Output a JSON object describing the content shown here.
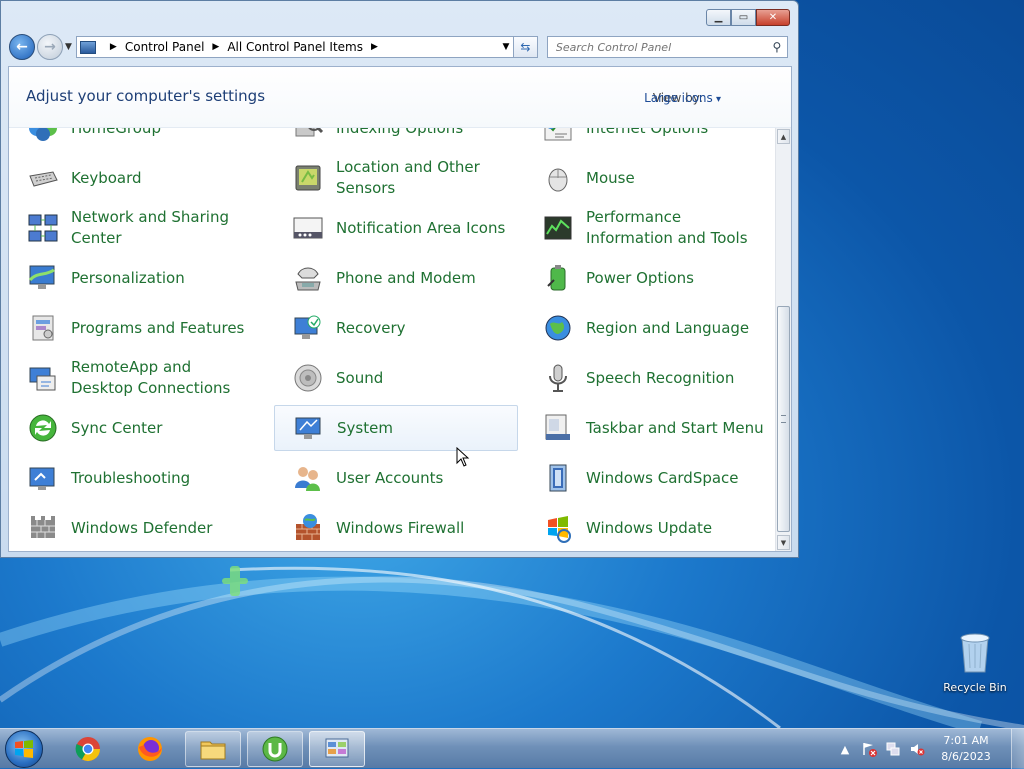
{
  "window": {
    "caption_buttons": {
      "minimize_icon": "minimize-icon",
      "maximize_icon": "maximize-icon",
      "close_icon": "close-icon"
    }
  },
  "navbar": {
    "breadcrumb": [
      "Control Panel",
      "All Control Panel Items"
    ],
    "search_placeholder": "Search Control Panel"
  },
  "content": {
    "title": "Adjust your computer's settings",
    "view_by_label": "View by:",
    "view_by_value": "Large icons"
  },
  "items": [
    {
      "label": "HomeGroup",
      "icon": "homegroup-icon",
      "col": 0,
      "row": 0,
      "clip": true
    },
    {
      "label": "Indexing Options",
      "icon": "indexing-options-icon",
      "col": 1,
      "row": 0,
      "clip": true
    },
    {
      "label": "Internet Options",
      "icon": "internet-options-icon",
      "col": 2,
      "row": 0,
      "clip": true
    },
    {
      "label": "Keyboard",
      "icon": "keyboard-icon",
      "col": 0,
      "row": 1
    },
    {
      "label": "Location and Other Sensors",
      "icon": "location-sensors-icon",
      "col": 1,
      "row": 1
    },
    {
      "label": "Mouse",
      "icon": "mouse-icon",
      "col": 2,
      "row": 1
    },
    {
      "label": "Network and Sharing Center",
      "icon": "network-icon",
      "col": 0,
      "row": 2
    },
    {
      "label": "Notification Area Icons",
      "icon": "notification-area-icon",
      "col": 1,
      "row": 2
    },
    {
      "label": "Performance Information and Tools",
      "icon": "performance-icon",
      "col": 2,
      "row": 2
    },
    {
      "label": "Personalization",
      "icon": "personalization-icon",
      "col": 0,
      "row": 3
    },
    {
      "label": "Phone and Modem",
      "icon": "phone-modem-icon",
      "col": 1,
      "row": 3
    },
    {
      "label": "Power Options",
      "icon": "power-options-icon",
      "col": 2,
      "row": 3
    },
    {
      "label": "Programs and Features",
      "icon": "programs-features-icon",
      "col": 0,
      "row": 4
    },
    {
      "label": "Recovery",
      "icon": "recovery-icon",
      "col": 1,
      "row": 4
    },
    {
      "label": "Region and Language",
      "icon": "region-language-icon",
      "col": 2,
      "row": 4
    },
    {
      "label": "RemoteApp and Desktop Connections",
      "icon": "remoteapp-icon",
      "col": 0,
      "row": 5
    },
    {
      "label": "Sound",
      "icon": "sound-icon",
      "col": 1,
      "row": 5
    },
    {
      "label": "Speech Recognition",
      "icon": "speech-recognition-icon",
      "col": 2,
      "row": 5
    },
    {
      "label": "Sync Center",
      "icon": "sync-center-icon",
      "col": 0,
      "row": 6
    },
    {
      "label": "System",
      "icon": "system-icon",
      "col": 1,
      "row": 6,
      "hover": true
    },
    {
      "label": "Taskbar and Start Menu",
      "icon": "taskbar-start-menu-icon",
      "col": 2,
      "row": 6
    },
    {
      "label": "Troubleshooting",
      "icon": "troubleshooting-icon",
      "col": 0,
      "row": 7
    },
    {
      "label": "User Accounts",
      "icon": "user-accounts-icon",
      "col": 1,
      "row": 7
    },
    {
      "label": "Windows CardSpace",
      "icon": "cardspace-icon",
      "col": 2,
      "row": 7
    },
    {
      "label": "Windows Defender",
      "icon": "defender-icon",
      "col": 0,
      "row": 8
    },
    {
      "label": "Windows Firewall",
      "icon": "firewall-icon",
      "col": 1,
      "row": 8
    },
    {
      "label": "Windows Update",
      "icon": "windows-update-icon",
      "col": 2,
      "row": 8
    }
  ],
  "desktop": {
    "recycle_bin_label": "Recycle Bin"
  },
  "taskbar": {
    "apps": [
      {
        "name": "chrome",
        "icon": "chrome-icon"
      },
      {
        "name": "firefox",
        "icon": "firefox-icon"
      },
      {
        "name": "explorer",
        "icon": "folder-icon"
      },
      {
        "name": "utorrent",
        "icon": "utorrent-icon"
      },
      {
        "name": "control-panel",
        "icon": "control-panel-icon"
      }
    ],
    "clock_time": "7:01 AM",
    "clock_date": "8/6/2023"
  },
  "colors": {
    "item_text": "#1f7132",
    "title_text": "#1e3f77",
    "link": "#1e4c97"
  }
}
